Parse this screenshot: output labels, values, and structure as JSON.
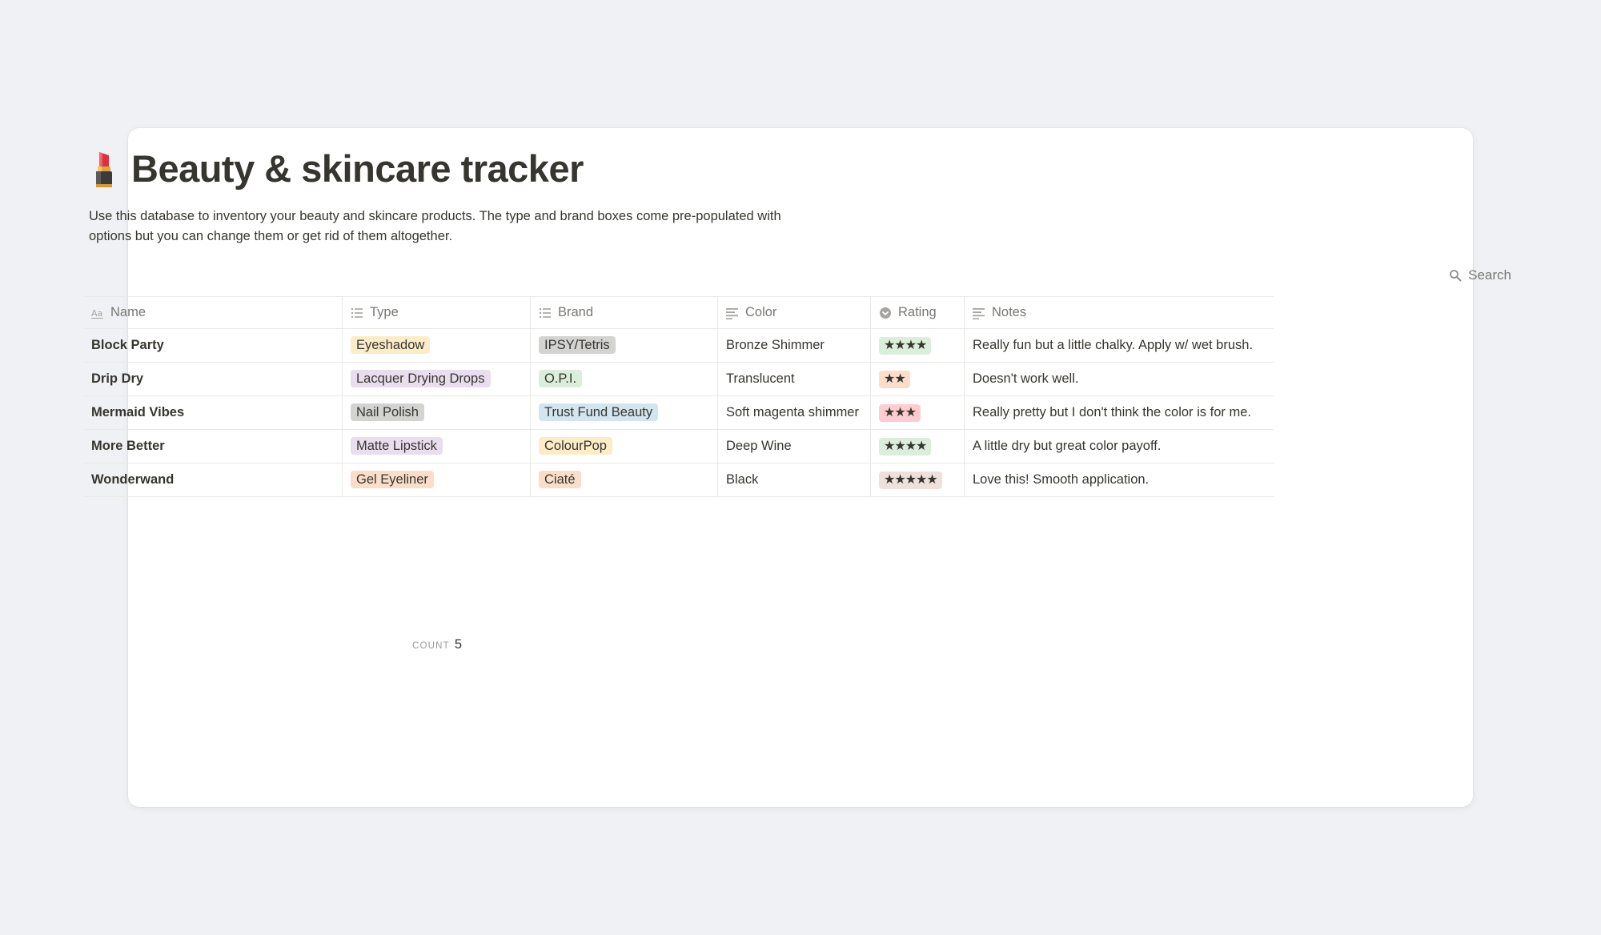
{
  "page": {
    "title": "Beauty & skincare tracker",
    "description": "Use this database to inventory your beauty and skincare products. The type and brand boxes come pre-populated with options but you can change them or get rid of them altogether.",
    "icon": "lipstick-icon"
  },
  "search": {
    "label": "Search",
    "icon": "search-icon"
  },
  "columns": {
    "name": {
      "label": "Name",
      "icon": "text-aa-icon"
    },
    "type": {
      "label": "Type",
      "icon": "list-icon"
    },
    "brand": {
      "label": "Brand",
      "icon": "list-icon"
    },
    "color": {
      "label": "Color",
      "icon": "lines-icon"
    },
    "rating": {
      "label": "Rating",
      "icon": "select-circle-icon"
    },
    "notes": {
      "label": "Notes",
      "icon": "lines-icon"
    }
  },
  "rows": [
    {
      "name": "Block Party",
      "type": {
        "label": "Eyeshadow",
        "color": "#fdecc8"
      },
      "brand": {
        "label": "IPSY/Tetris",
        "color": "#d3d3d1"
      },
      "color": "Bronze Shimmer",
      "rating": {
        "label": "★★★★",
        "color": "#dbeddb"
      },
      "notes": "Really fun but a little chalky. Apply w/ wet brush."
    },
    {
      "name": "Drip Dry",
      "type": {
        "label": "Lacquer Drying Drops",
        "color": "#e8deee"
      },
      "brand": {
        "label": "O.P.I.",
        "color": "#dbeddb"
      },
      "color": "Translucent",
      "rating": {
        "label": "★★",
        "color": "#fadec9"
      },
      "notes": "Doesn't work well."
    },
    {
      "name": "Mermaid Vibes",
      "type": {
        "label": "Nail Polish",
        "color": "#d3d3d1"
      },
      "brand": {
        "label": "Trust Fund Beauty",
        "color": "#d3e5ef"
      },
      "color": "Soft magenta shimmer",
      "rating": {
        "label": "★★★",
        "color": "#ffcccf"
      },
      "notes": "Really pretty but I don't think the color is for me."
    },
    {
      "name": "More Better",
      "type": {
        "label": "Matte Lipstick",
        "color": "#e8deee"
      },
      "brand": {
        "label": "ColourPop",
        "color": "#fdecc8"
      },
      "color": "Deep Wine",
      "rating": {
        "label": "★★★★",
        "color": "#dbeddb"
      },
      "notes": "A little dry but great color payoff."
    },
    {
      "name": "Wonderwand",
      "type": {
        "label": "Gel Eyeliner",
        "color": "#fadec9"
      },
      "brand": {
        "label": "Ciaté",
        "color": "#fadec9"
      },
      "color": "Black",
      "rating": {
        "label": "★★★★★",
        "color": "#eee0da"
      },
      "notes": "Love this! Smooth application."
    }
  ],
  "footer": {
    "count_label": "COUNT",
    "count_value": "5"
  }
}
